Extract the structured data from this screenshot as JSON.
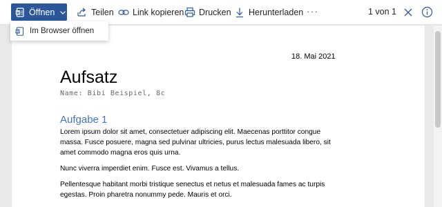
{
  "toolbar": {
    "open_label": "Öffnen",
    "share_label": "Teilen",
    "copy_link_label": "Link kopieren",
    "print_label": "Drucken",
    "download_label": "Herunterladen",
    "more_label": "···",
    "page_indicator": "1 von 1"
  },
  "dropdown": {
    "item_label": "Im Browser öffnen"
  },
  "document": {
    "date": "18. Mai 2021",
    "title": "Aufsatz",
    "subtitle": "Name: Bibi Beispiel, 8c",
    "heading": "Aufgabe 1",
    "paragraphs": [
      "Lorem ipsum dolor sit amet, consectetuer adipiscing elit. Maecenas porttitor congue massa. Fusce posuere, magna sed pulvinar ultricies, purus lectus malesuada libero, sit amet commodo magna eros quis urna.",
      "Nunc viverra imperdiet enim. Fusce est. Vivamus a tellus.",
      "Pellentesque habitant morbi tristique senectus et netus et malesuada fames ac turpis egestas. Proin pharetra nonummy pede. Mauris et orci."
    ]
  },
  "colors": {
    "accent": "#2b579a",
    "heading": "#4472c4",
    "icon": "#2b579a"
  },
  "icons": {
    "open": "word-doc-icon",
    "share": "share-icon",
    "copy_link": "link-icon",
    "print": "printer-icon",
    "download": "download-icon",
    "close": "close-icon",
    "info": "info-icon"
  }
}
